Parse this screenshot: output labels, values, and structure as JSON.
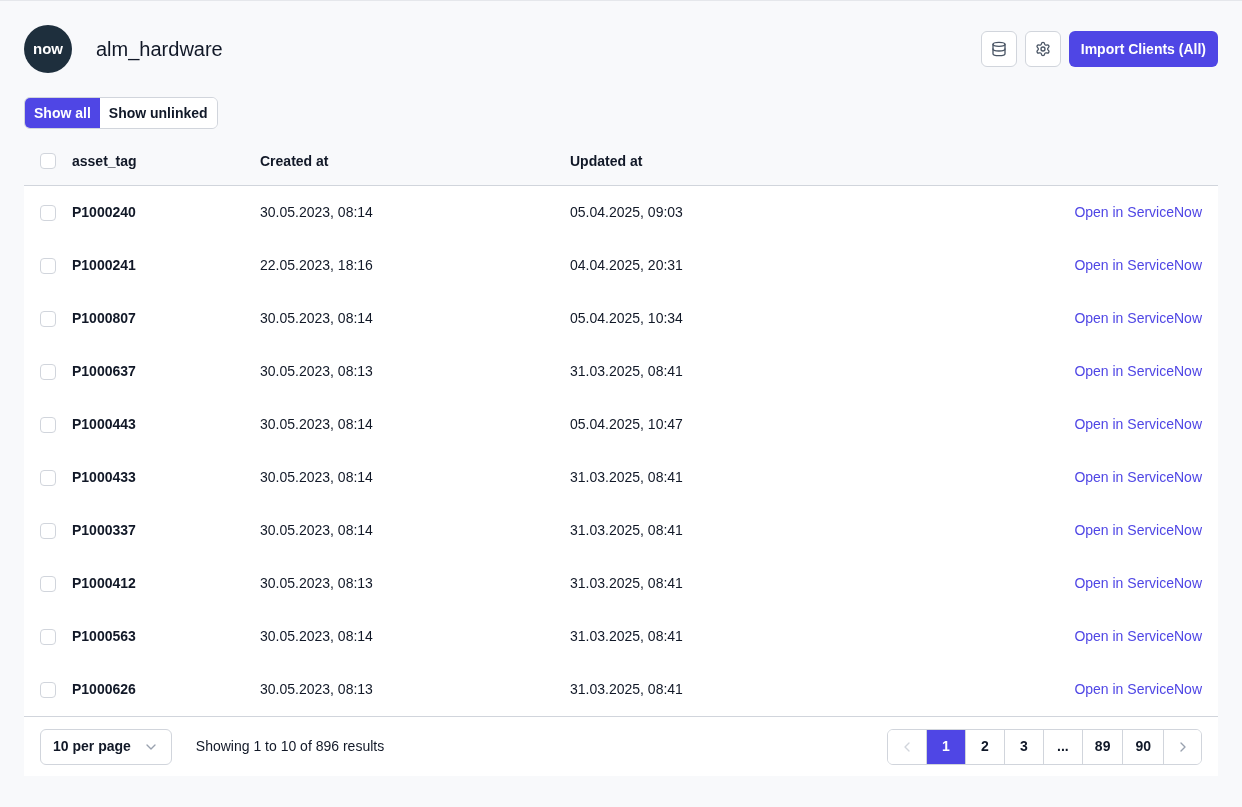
{
  "header": {
    "logo_text": "now",
    "title": "alm_hardware",
    "import_button": "Import Clients (All)"
  },
  "filters": [
    {
      "label": "Show all",
      "selected": true
    },
    {
      "label": "Show unlinked",
      "selected": false
    }
  ],
  "table": {
    "columns": [
      "asset_tag",
      "Created at",
      "Updated at"
    ],
    "select_all_checked": false,
    "rows": [
      {
        "asset_tag": "P1000240",
        "created": "30.05.2023, 08:14",
        "updated": "05.04.2025, 09:03",
        "link": "Open in ServiceNow",
        "checked": false
      },
      {
        "asset_tag": "P1000241",
        "created": "22.05.2023, 18:16",
        "updated": "04.04.2025, 20:31",
        "link": "Open in ServiceNow",
        "checked": false
      },
      {
        "asset_tag": "P1000807",
        "created": "30.05.2023, 08:14",
        "updated": "05.04.2025, 10:34",
        "link": "Open in ServiceNow",
        "checked": false
      },
      {
        "asset_tag": "P1000637",
        "created": "30.05.2023, 08:13",
        "updated": "31.03.2025, 08:41",
        "link": "Open in ServiceNow",
        "checked": false
      },
      {
        "asset_tag": "P1000443",
        "created": "30.05.2023, 08:14",
        "updated": "05.04.2025, 10:47",
        "link": "Open in ServiceNow",
        "checked": false
      },
      {
        "asset_tag": "P1000433",
        "created": "30.05.2023, 08:14",
        "updated": "31.03.2025, 08:41",
        "link": "Open in ServiceNow",
        "checked": false
      },
      {
        "asset_tag": "P1000337",
        "created": "30.05.2023, 08:14",
        "updated": "31.03.2025, 08:41",
        "link": "Open in ServiceNow",
        "checked": false
      },
      {
        "asset_tag": "P1000412",
        "created": "30.05.2023, 08:13",
        "updated": "31.03.2025, 08:41",
        "link": "Open in ServiceNow",
        "checked": false
      },
      {
        "asset_tag": "P1000563",
        "created": "30.05.2023, 08:14",
        "updated": "31.03.2025, 08:41",
        "link": "Open in ServiceNow",
        "checked": false
      },
      {
        "asset_tag": "P1000626",
        "created": "30.05.2023, 08:13",
        "updated": "31.03.2025, 08:41",
        "link": "Open in ServiceNow",
        "checked": false
      }
    ]
  },
  "footer": {
    "per_page": "10 per page",
    "summary": "Showing 1 to 10 of 896 results",
    "pages": [
      {
        "label": "1",
        "selected": true
      },
      {
        "label": "2",
        "selected": false
      },
      {
        "label": "3",
        "selected": false
      },
      {
        "label": "...",
        "selected": false
      },
      {
        "label": "89",
        "selected": false
      },
      {
        "label": "90",
        "selected": false
      }
    ]
  }
}
